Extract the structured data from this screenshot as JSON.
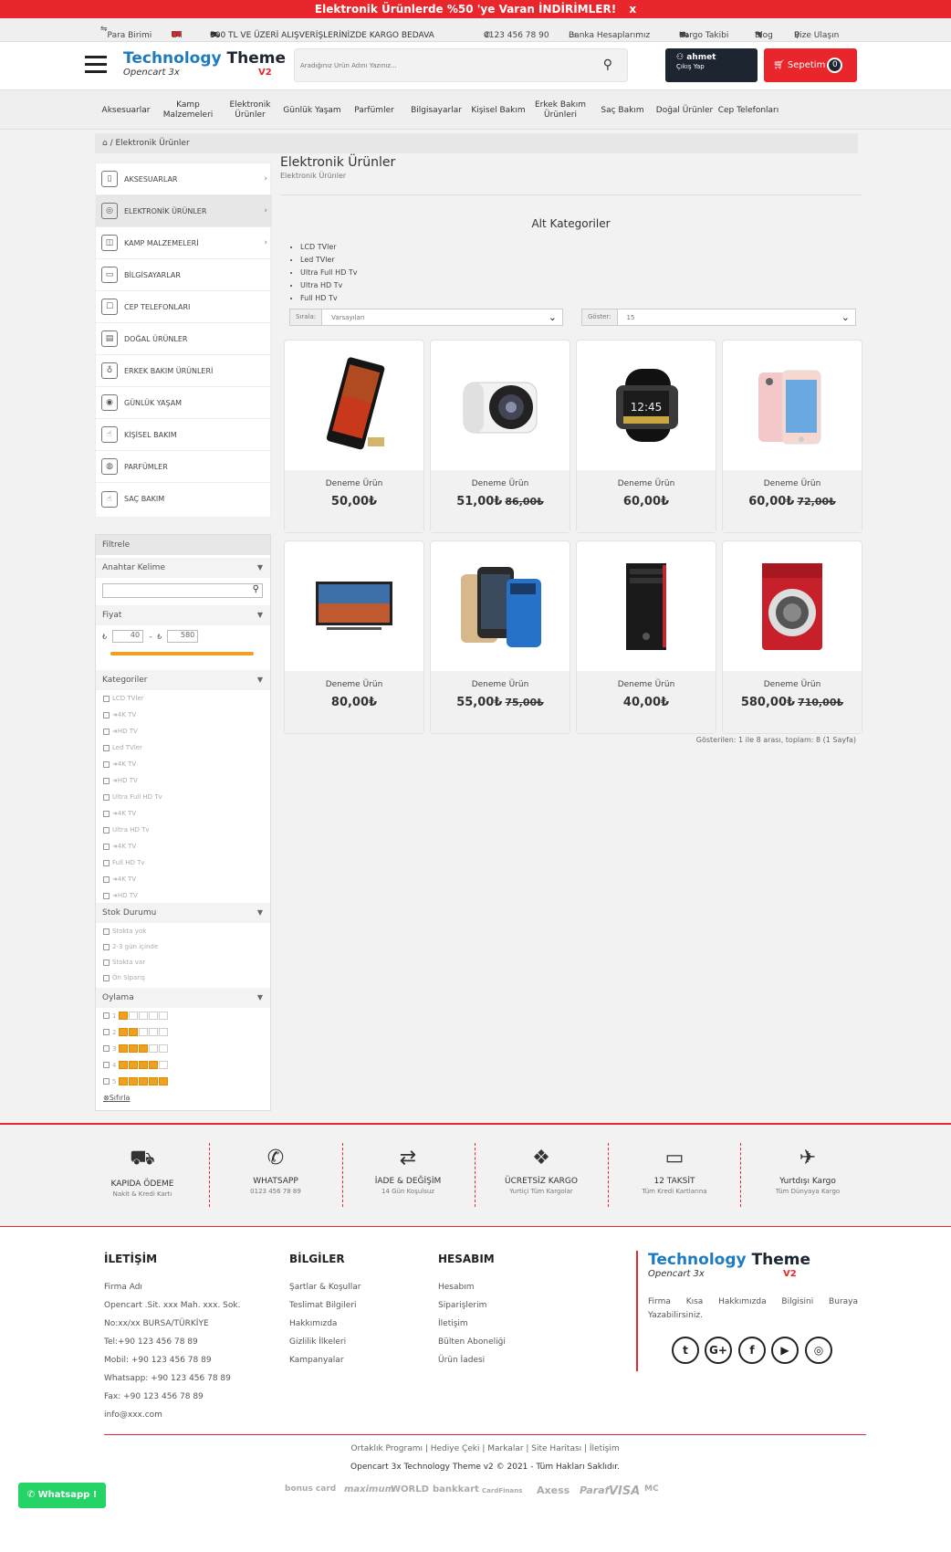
{
  "banner": {
    "text": "Elektronik Ürünlerde %50 'ye Varan İNDİRİMLER!",
    "close": "x"
  },
  "topbar": {
    "currency": "Para Birimi",
    "language": "Dil",
    "shipping": "500 TL VE ÜZERİ ALIŞVERİŞLERİNİZDE KARGO BEDAVA",
    "phone": "0123 456 78 90",
    "bank": "Banka Hesaplarımız",
    "cargo": "Kargo Takibi",
    "blog": "Blog",
    "contact": "Bize Ulaşın"
  },
  "header": {
    "logo_main": "Technology",
    "logo_theme": "Theme",
    "logo_sub": "Opencart 3x",
    "logo_v": "V2",
    "search_placeholder": "Aradığınız Ürün Adını Yazınız...",
    "user_name": "ahmet",
    "user_logout": "Çıkış Yap",
    "cart_label": "Sepetim",
    "cart_count": "0"
  },
  "nav": [
    {
      "label": "Aksesuarlar"
    },
    {
      "label": "Kamp Malzemeleri"
    },
    {
      "label": "Elektronik Ürünler"
    },
    {
      "label": "Günlük Yaşam"
    },
    {
      "label": "Parfümler"
    },
    {
      "label": "Bilgisayarlar"
    },
    {
      "label": "Kişisel Bakım"
    },
    {
      "label": "Erkek Bakım Ürünleri"
    },
    {
      "label": "Saç Bakım"
    },
    {
      "label": "Doğal Ürünler"
    },
    {
      "label": "Cep Telefonları"
    }
  ],
  "breadcrumb": {
    "current": "Elektronik Ürünler"
  },
  "sidebar": [
    {
      "label": "AKSESUARLAR",
      "icon": "▯"
    },
    {
      "label": "ELEKTRONİK ÜRÜNLER",
      "icon": "◎"
    },
    {
      "label": "KAMP MALZEMELERİ",
      "icon": "◫"
    },
    {
      "label": "BİLGİSAYARLAR",
      "icon": "▭"
    },
    {
      "label": "CEP TELEFONLARI",
      "icon": "☐"
    },
    {
      "label": "DOĞAL ÜRÜNLER",
      "icon": "▤"
    },
    {
      "label": "ERKEK BAKIM ÜRÜNLERİ",
      "icon": "♁"
    },
    {
      "label": "GÜNLÜK YAŞAM",
      "icon": "◉"
    },
    {
      "label": "KİŞİSEL BAKIM",
      "icon": "☝"
    },
    {
      "label": "PARFÜMLER",
      "icon": "◍"
    },
    {
      "label": "SAÇ BAKIM",
      "icon": "☝"
    }
  ],
  "filter": {
    "title": "Filtrele",
    "keyword": "Anahtar Kelime",
    "price": "Fiyat",
    "price_min": "40",
    "price_max": "580",
    "currency": "₺",
    "categories_title": "Kategoriler",
    "categories": [
      "LCD TVler",
      "4K TV",
      "HD TV",
      "Led TVler",
      "4K TV",
      "HD TV",
      "Ultra Full HD Tv",
      "4K TV",
      "Ultra HD Tv",
      "4K TV",
      "Full HD Tv",
      "4K TV",
      "HD TV"
    ],
    "stock_title": "Stok Durumu",
    "stock": [
      "Stokta yok",
      "2-3 gün içinde",
      "Stokta var",
      "Ön Sipariş"
    ],
    "rating_title": "Oylama",
    "ratings": [
      "1",
      "2",
      "3",
      "4",
      "5"
    ],
    "reset": "Sıfırla"
  },
  "main": {
    "title": "Elektronik Ürünler",
    "subtitle": "Elektronik Ürünler",
    "subcat_title": "Alt Kategoriler",
    "subcats": [
      "LCD TVler",
      "Led TVler",
      "Ultra Full HD Tv",
      "Ultra HD Tv",
      "Full HD Tv"
    ],
    "sort_label": "Sırala:",
    "sort_value": "Varsayılan",
    "show_label": "Göster:",
    "show_value": "15",
    "pagination": "Gösterilen: 1 ile 8 arası, toplam: 8 (1 Sayfa)"
  },
  "products": [
    {
      "name": "Deneme Ürün",
      "price": "50,00₺",
      "old": "",
      "img": "phone-black"
    },
    {
      "name": "Deneme Ürün",
      "price": "51,00₺",
      "old": "86,00₺",
      "img": "camera"
    },
    {
      "name": "Deneme Ürün",
      "price": "60,00₺",
      "old": "",
      "img": "watch"
    },
    {
      "name": "Deneme Ürün",
      "price": "60,00₺",
      "old": "72,00₺",
      "img": "phone-pink"
    },
    {
      "name": "Deneme Ürün",
      "price": "80,00₺",
      "old": "",
      "img": "tv"
    },
    {
      "name": "Deneme Ürün",
      "price": "55,00₺",
      "old": "75,00₺",
      "img": "cases"
    },
    {
      "name": "Deneme Ürün",
      "price": "40,00₺",
      "old": "",
      "img": "pc"
    },
    {
      "name": "Deneme Ürün",
      "price": "580,00₺",
      "old": "710,00₺",
      "img": "washer"
    }
  ],
  "features": [
    {
      "title": "KAPIDA ÖDEME",
      "sub": "Nakit & Kredi Kartı",
      "icon": "⛟"
    },
    {
      "title": "WHATSAPP",
      "sub": "0123 456 78 89",
      "icon": "✆"
    },
    {
      "title": "İADE & DEĞİŞİM",
      "sub": "14 Gün Koşulsuz",
      "icon": "⇄"
    },
    {
      "title": "ÜCRETSİZ KARGO",
      "sub": "Yurtiçi Tüm Kargolar",
      "icon": "❖"
    },
    {
      "title": "12 TAKSİT",
      "sub": "Tüm Kredi Kartlarına",
      "icon": "▭"
    },
    {
      "title": "Yurtdışı Kargo",
      "sub": "Tüm Dünyaya Kargo",
      "icon": "✈"
    }
  ],
  "footer": {
    "contact_title": "İLETİŞİM",
    "contact": [
      "Firma Adı",
      "Opencart .Sit. xxx Mah. xxx. Sok.",
      "No:xx/xx BURSA/TÜRKİYE",
      "Tel:+90 123 456 78 89",
      "Mobil: +90 123 456 78 89",
      "Whatsapp: +90 123 456 78 89",
      "Fax: +90 123 456 78 89",
      "info@xxx.com"
    ],
    "info_title": "BİLGİLER",
    "info": [
      "Şartlar & Koşullar",
      "Teslimat Bilgileri",
      "Hakkımızda",
      "Gizlilik İlkeleri",
      "Kampanyalar"
    ],
    "account_title": "HESABIM",
    "account": [
      "Hesabım",
      "Siparişlerim",
      "İletişim",
      "Bülten Aboneliği",
      "Ürün İadesi"
    ],
    "about": "Firma Kısa Hakkımızda Bilgisini Buraya Yazabilirsiniz.",
    "links": "Ortaklık Programı | Hediye Çeki | Markalar | Site Haritası | İletişim",
    "copyright": "Opencart 3x Technology Theme v2 © 2021 - Tüm Hakları Saklıdır.",
    "payments": [
      "bonus card",
      "maximum",
      "WORLD",
      "bankkart",
      "CardFinans",
      "Axess",
      "Paraf",
      "VISA",
      "MC"
    ],
    "whatsapp": "Whatsapp !"
  },
  "colors": {
    "accent": "#e8262b",
    "brand_blue": "#1e7bc0",
    "dark": "#1c2530"
  }
}
